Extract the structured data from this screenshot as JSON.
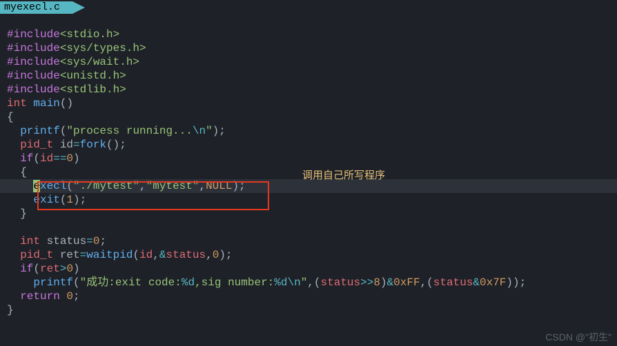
{
  "tab": {
    "label": "myexecl.c"
  },
  "annotation": "调用自己所写程序",
  "watermark": "CSDN @\"初生\"",
  "tok": {
    "include": "#include",
    "h1": "<stdio.h>",
    "h2": "<sys/types.h>",
    "h3": "<sys/wait.h>",
    "h4": "<unistd.h>",
    "h5": "<stdlib.h>",
    "int": "int",
    "main": "main",
    "lpar": "(",
    "rpar": ")",
    "lbr": "{",
    "rbr": "}",
    "printf": "printf",
    "s_running": "\"process running...",
    "bs_n": "\\n",
    "q_close": "\"",
    "semi": ";",
    "pid_t": "pid_t",
    "id_decl": " id",
    "eq": "=",
    "fork": "fork",
    "if": "if",
    "id": "id",
    "eqeq": "==",
    "zero": "0",
    "e_cursor": "e",
    "xecl": "xecl",
    "s_mytest_path": "\"./mytest\"",
    "comma": ",",
    "s_mytest": "\"mytest\"",
    "null": "NULL",
    "exit": "exit",
    "one": "1",
    "status_decl": " status",
    "ret_decl": " ret",
    "waitpid": "waitpid",
    "amp": "&",
    "status": "status",
    "ret": "ret",
    "gt": ">",
    "s_success1": "\"成功:exit code:",
    "pd": "%d",
    "s_success2": ",sig number:",
    "rshift": ">>",
    "eight": "8",
    "hexFF": "0xFF",
    "hex7F": "0x7F",
    "return": "return"
  }
}
